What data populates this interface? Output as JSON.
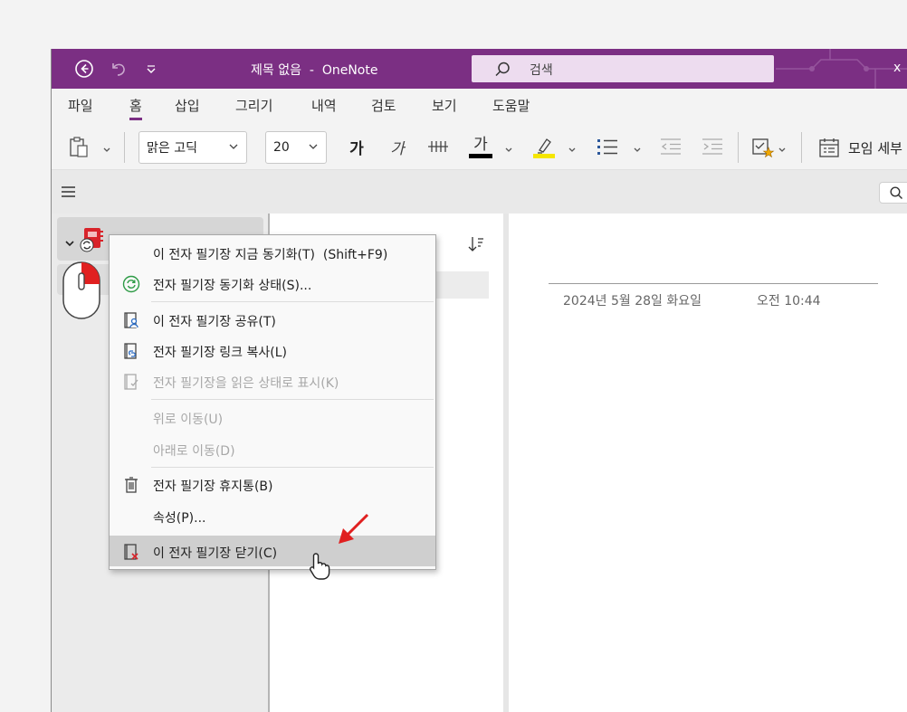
{
  "titlebar": {
    "title": "제목 없음  -  OneNote",
    "search_placeholder": "검색",
    "truncated_label": "x",
    "back_icon": "back-arrow-circle-icon",
    "undo_icon": "undo-icon",
    "qat_icon": "customize-quick-access-icon"
  },
  "menu": {
    "tabs": [
      {
        "label": "파일"
      },
      {
        "label": "홈",
        "active": true
      },
      {
        "label": "삽입"
      },
      {
        "label": "그리기"
      },
      {
        "label": "내역"
      },
      {
        "label": "검토"
      },
      {
        "label": "보기"
      },
      {
        "label": "도움말"
      }
    ]
  },
  "ribbon": {
    "font_name": "맑은 고딕",
    "font_size": "20",
    "bold_glyph": "가",
    "italic_glyph": "가",
    "font_color_glyph": "가",
    "meeting_details_label": "모임 세부"
  },
  "page": {
    "date": "2024년 5월 28일 화요일",
    "time": "오전 10:44"
  },
  "context_menu": {
    "items": [
      {
        "label": "이 전자 필기장 지금 동기화(T)  (Shift+F9)",
        "icon": "none",
        "enabled": true
      },
      {
        "label": "전자 필기장 동기화 상태(S)...",
        "icon": "sync-status-icon",
        "enabled": true
      },
      {
        "label": "이 전자 필기장 공유(T)",
        "icon": "share-notebook-icon",
        "enabled": true
      },
      {
        "label": "전자 필기장 링크 복사(L)",
        "icon": "copy-link-icon",
        "enabled": true
      },
      {
        "label": "전자 필기장을 읽은 상태로 표시(K)",
        "icon": "mark-read-icon",
        "enabled": false
      },
      {
        "label": "위로 이동(U)",
        "icon": "none",
        "enabled": false
      },
      {
        "label": "아래로 이동(D)",
        "icon": "none",
        "enabled": false
      },
      {
        "label": "전자 필기장 휴지통(B)",
        "icon": "trash-icon",
        "enabled": true
      },
      {
        "label": "속성(P)...",
        "icon": "none",
        "enabled": true
      },
      {
        "label": "이 전자 필기장 닫기(C)",
        "icon": "close-notebook-icon",
        "enabled": true,
        "highlighted": true
      }
    ]
  },
  "colors": {
    "brand": "#7b2f83",
    "search_box": "#eddcef",
    "annotation_arrow": "#e02020",
    "font_color_bar": "#000000",
    "highlight_bar": "#f5e600"
  }
}
